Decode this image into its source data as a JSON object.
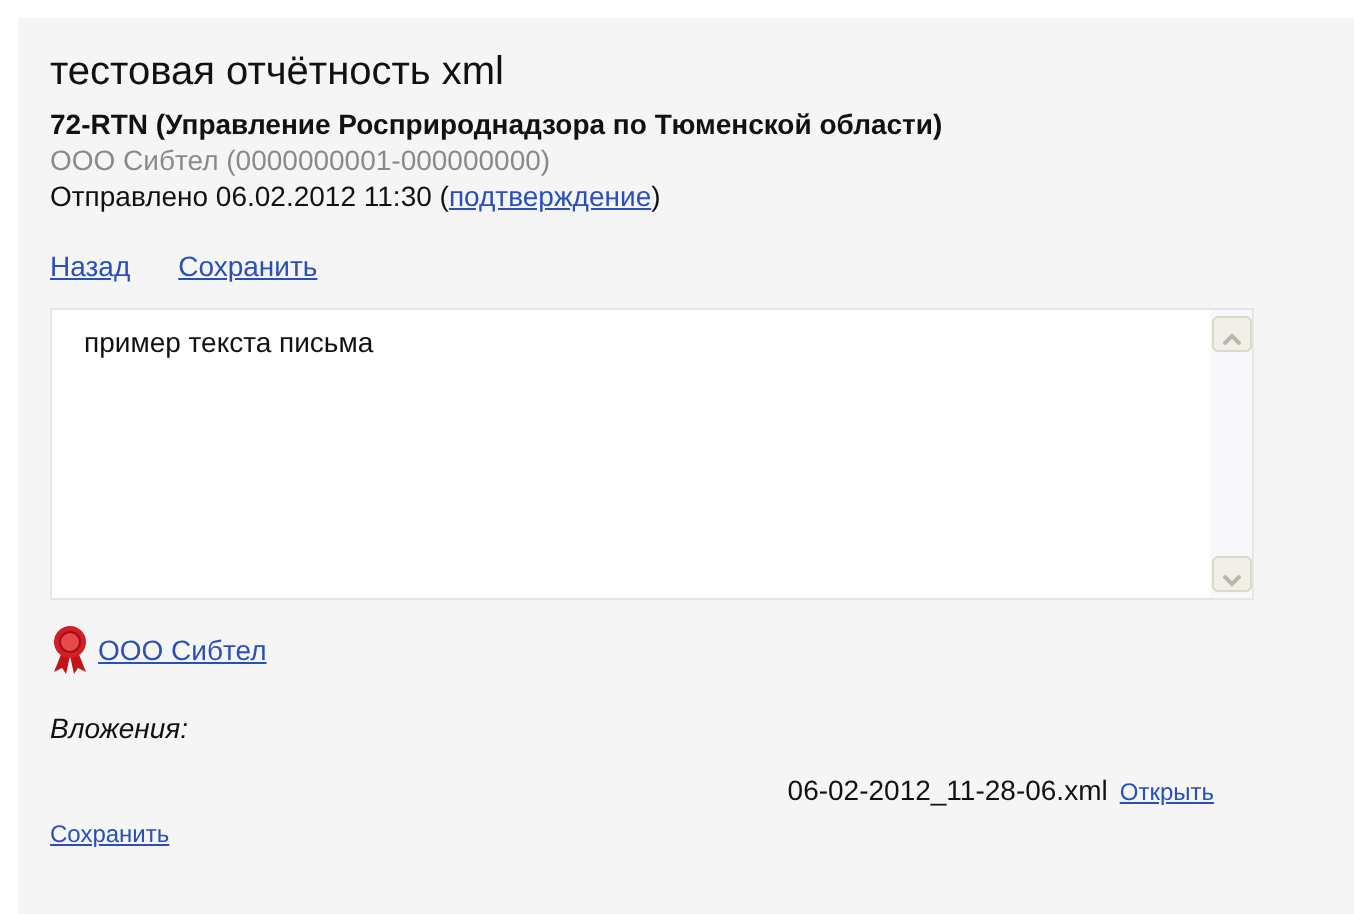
{
  "title": "тестовая отчётность xml",
  "recipient": "72-RTN (Управление Росприроднадзора по Тюменской области)",
  "sender": "ООО Сибтел (0000000001-000000000)",
  "sent": {
    "prefix": "Отправлено 06.02.2012 11:30 (",
    "link": "подтверждение",
    "suffix": ")"
  },
  "actions": [
    "Назад",
    "Сохранить"
  ],
  "message": {
    "value": "пример текста письма"
  },
  "signature": {
    "label": "ООО Сибтел"
  },
  "attachments": {
    "label": "Вложения:",
    "files": [
      {
        "name": "06-02-2012_11-28-06.xml",
        "open_link": "Открыть"
      }
    ],
    "save_link": "Сохранить"
  }
}
